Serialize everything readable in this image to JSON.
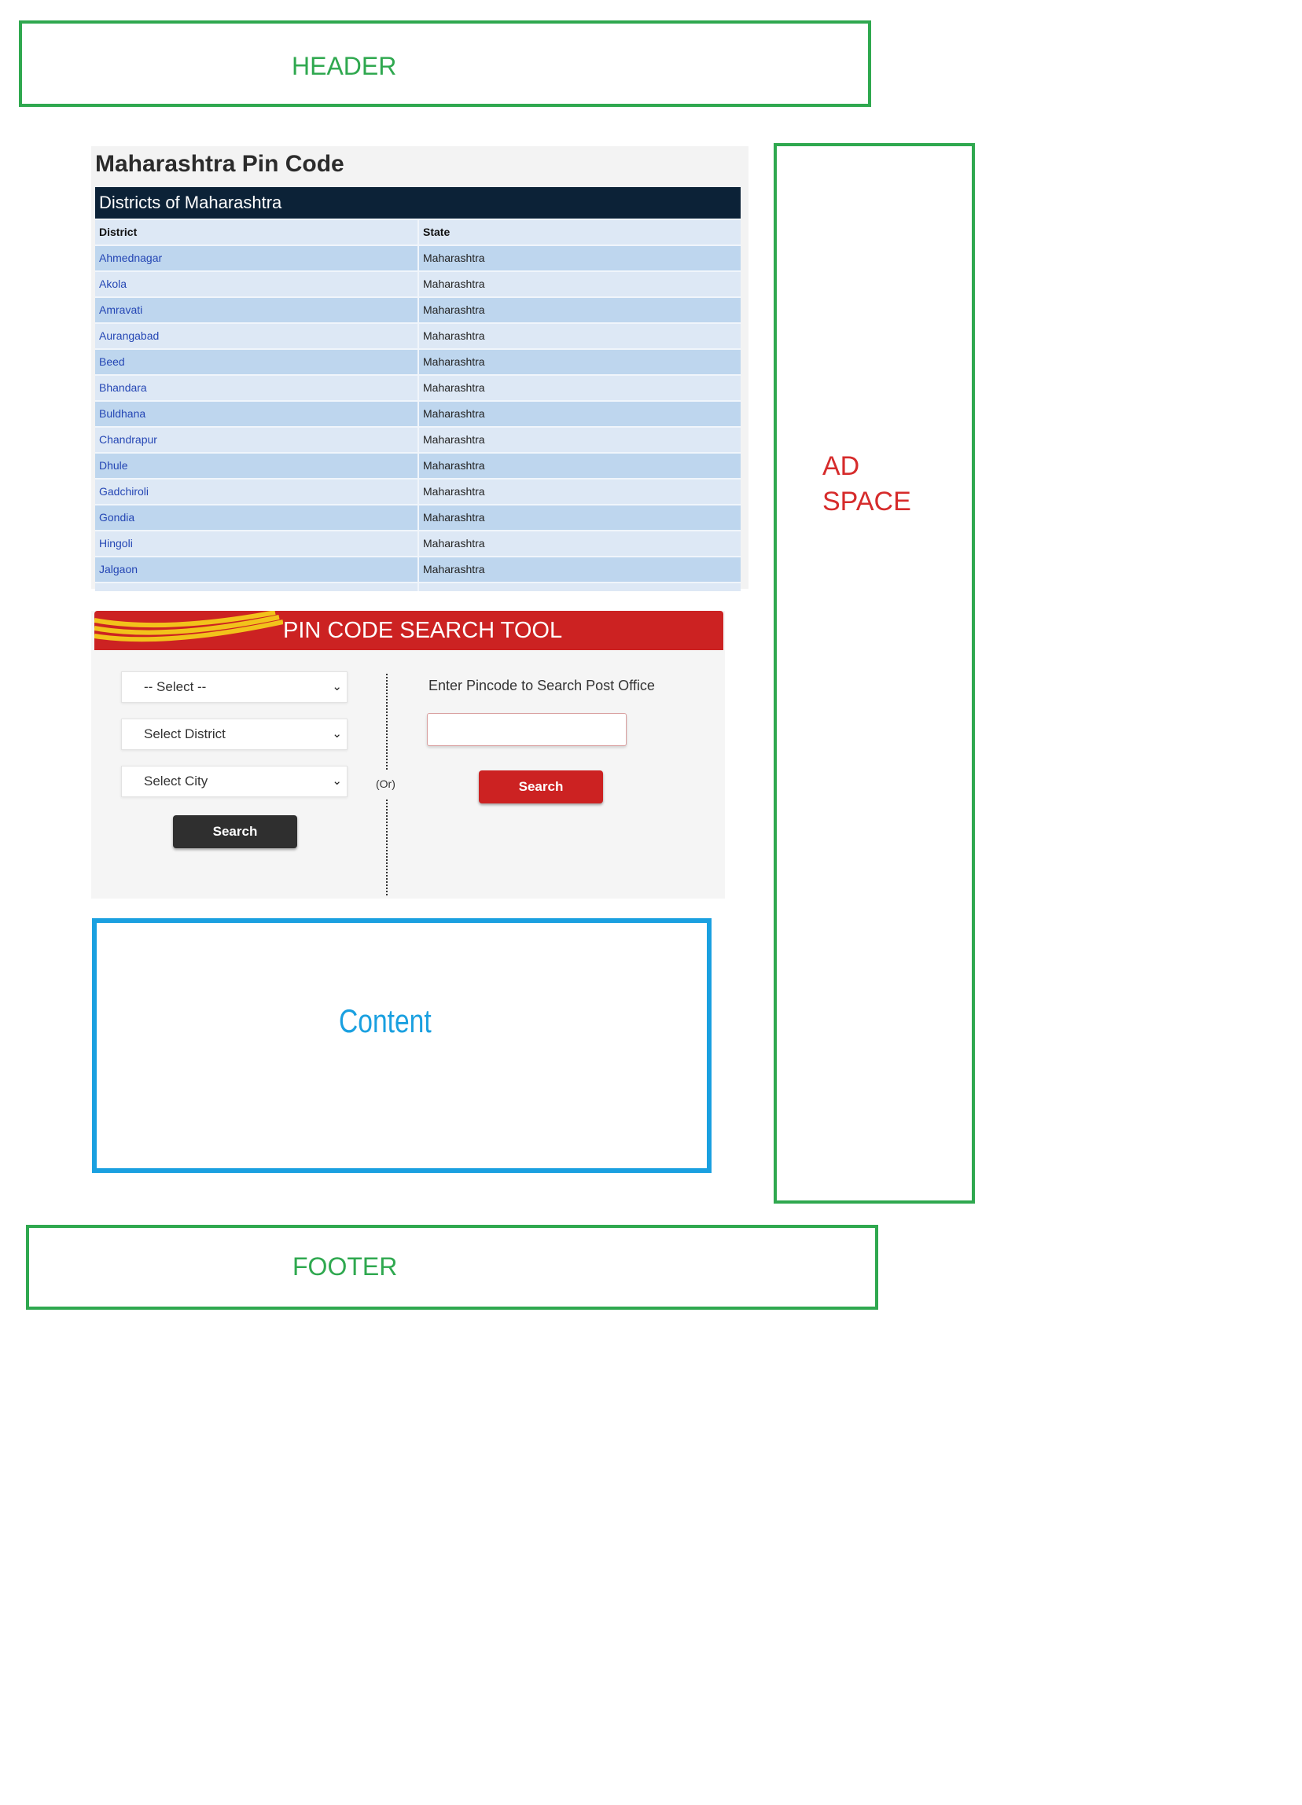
{
  "wireframe": {
    "header_label": "HEADER",
    "footer_label": "FOOTER",
    "ad_label_line1": "AD",
    "ad_label_line2": "SPACE",
    "content_label": "Content"
  },
  "district_panel": {
    "title": "Maharashtra Pin Code",
    "table_caption": "Districts of Maharashtra",
    "columns": [
      "District",
      "State"
    ],
    "rows": [
      [
        "Ahmednagar",
        "Maharashtra"
      ],
      [
        "Akola",
        "Maharashtra"
      ],
      [
        "Amravati",
        "Maharashtra"
      ],
      [
        "Aurangabad",
        "Maharashtra"
      ],
      [
        "Beed",
        "Maharashtra"
      ],
      [
        "Bhandara",
        "Maharashtra"
      ],
      [
        "Buldhana",
        "Maharashtra"
      ],
      [
        "Chandrapur",
        "Maharashtra"
      ],
      [
        "Dhule",
        "Maharashtra"
      ],
      [
        "Gadchiroli",
        "Maharashtra"
      ],
      [
        "Gondia",
        "Maharashtra"
      ],
      [
        "Hingoli",
        "Maharashtra"
      ],
      [
        "Jalgaon",
        "Maharashtra"
      ]
    ]
  },
  "search_tool": {
    "title": "PIN CODE SEARCH TOOL",
    "state_select": "-- Select --",
    "district_select": "Select District",
    "city_select": "Select City",
    "left_search_label": "Search",
    "or_label": "(Or)",
    "pincode_prompt": "Enter Pincode to Search Post Office",
    "pincode_value": "",
    "right_search_label": "Search"
  },
  "colors": {
    "wireframe_green": "#2fa84f",
    "ad_red": "#d62b2b",
    "content_blue": "#1aa0e0",
    "table_header_navy": "#0c2237",
    "brand_red": "#cc2222"
  }
}
